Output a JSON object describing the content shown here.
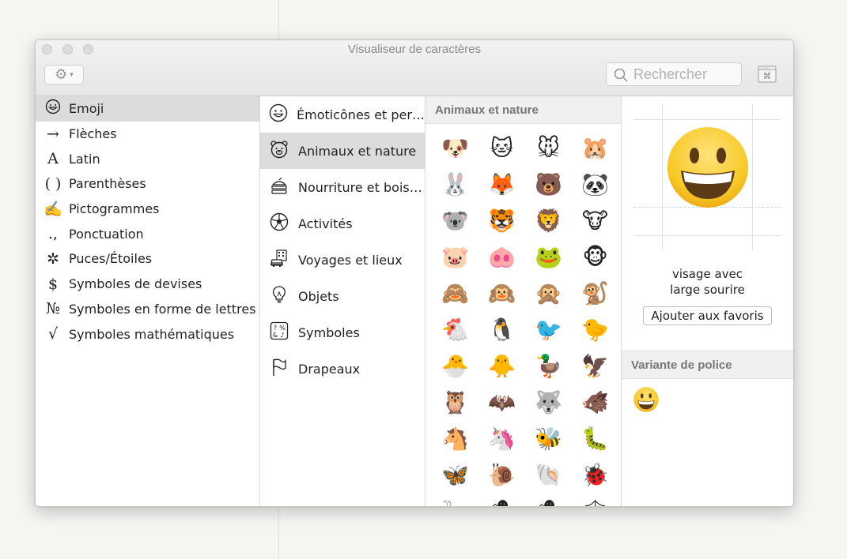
{
  "window": {
    "title": "Visualiseur de caractères"
  },
  "toolbar": {
    "search_placeholder": "Rechercher"
  },
  "categories": [
    {
      "label": "Emoji",
      "icon": "☺",
      "selected": true
    },
    {
      "label": "Flèches",
      "icon": "→"
    },
    {
      "label": "Latin",
      "icon": "A"
    },
    {
      "label": "Parenthèses",
      "icon": "( )"
    },
    {
      "label": "Pictogrammes",
      "icon": "✍"
    },
    {
      "label": "Ponctuation",
      "icon": ".,"
    },
    {
      "label": "Puces/Étoiles",
      "icon": "✲"
    },
    {
      "label": "Symboles de devises",
      "icon": "$"
    },
    {
      "label": "Symboles en forme de lettres",
      "icon": "№"
    },
    {
      "label": "Symboles mathématiques",
      "icon": "√"
    }
  ],
  "subcategories": [
    {
      "label": "Émoticônes et per…",
      "icon": "smiley-icon"
    },
    {
      "label": "Animaux et nature",
      "icon": "bear-icon",
      "selected": true
    },
    {
      "label": "Nourriture et bois…",
      "icon": "food-icon"
    },
    {
      "label": "Activités",
      "icon": "ball-icon"
    },
    {
      "label": "Voyages et lieux",
      "icon": "car-building-icon"
    },
    {
      "label": "Objets",
      "icon": "lightbulb-icon"
    },
    {
      "label": "Symboles",
      "icon": "symbols-icon"
    },
    {
      "label": "Drapeaux",
      "icon": "flag-icon"
    }
  ],
  "grid": {
    "header": "Animaux et nature",
    "emoji": [
      "🐶",
      "🐱",
      "🐭",
      "🐹",
      "🐰",
      "🦊",
      "🐻",
      "🐼",
      "🐨",
      "🐯",
      "🦁",
      "🐮",
      "🐷",
      "🐽",
      "🐸",
      "🐵",
      "🙈",
      "🙉",
      "🙊",
      "🐒",
      "🐔",
      "🐧",
      "🐦",
      "🐤",
      "🐣",
      "🐥",
      "🦆",
      "🦅",
      "🦉",
      "🦇",
      "🐺",
      "🐗",
      "🐴",
      "🦄",
      "🐝",
      "🐛",
      "🦋",
      "🐌",
      "🐚",
      "🐞",
      "🐜",
      "🕷",
      "🕷",
      "🕸"
    ]
  },
  "detail": {
    "char": "😀",
    "name_line1": "visage avec",
    "name_line2": "large sourire",
    "fav_button": "Ajouter aux favoris",
    "variant_header": "Variante de police",
    "variant_char": "😀"
  },
  "colors": {
    "selection": "#dcdcdc",
    "face_yellow": "#f8c927"
  }
}
